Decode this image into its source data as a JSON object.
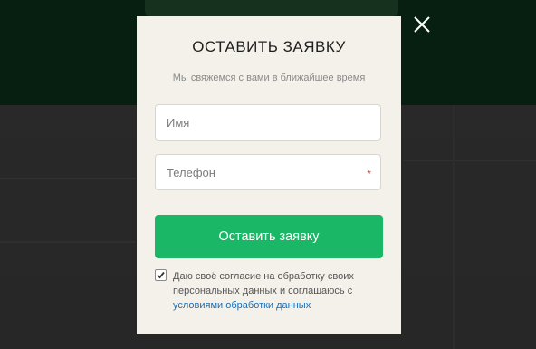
{
  "background": {
    "header_color": "#0c3a1e"
  },
  "modal": {
    "title": "ОСТАВИТЬ ЗАЯВКУ",
    "subtitle": "Мы свяжемся с вами в ближайшее время",
    "name_field": {
      "placeholder": "Имя",
      "value": ""
    },
    "phone_field": {
      "placeholder": "Телефон",
      "value": "",
      "required_mark": "*"
    },
    "submit_label": "Оставить заявку",
    "consent": {
      "checked": true,
      "text": "Даю своё согласие на обработку своих персональных данных и соглашаюсь с",
      "link_text": "условиями обработки данных"
    },
    "accent_color": "#1ab866",
    "link_color": "#1a6fb5"
  },
  "icons": {
    "close": "close-icon",
    "check": "checkmark-icon"
  }
}
